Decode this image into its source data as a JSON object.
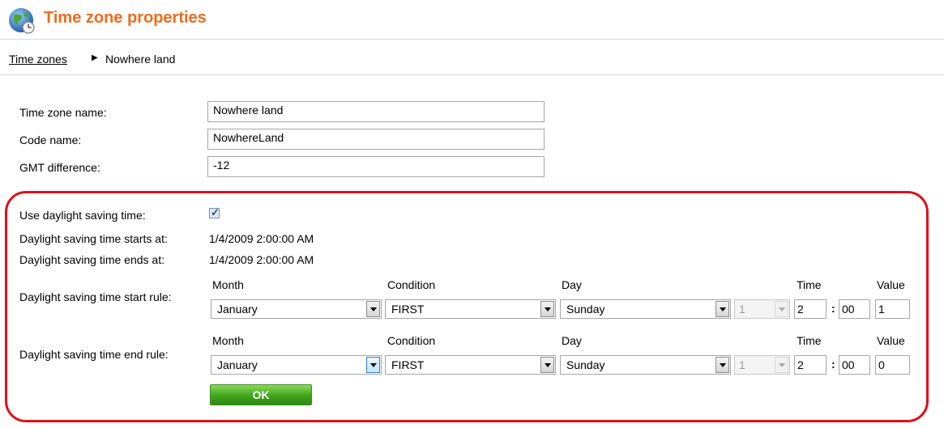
{
  "header": {
    "title": "Time zone properties",
    "icon": "globe-clock-icon"
  },
  "breadcrumb": {
    "parent": "Time zones",
    "current": "Nowhere land"
  },
  "form": {
    "name_label": "Time zone name:",
    "name_value": "Nowhere land",
    "code_label": "Code name:",
    "code_value": "NowhereLand",
    "gmt_label": "GMT difference:",
    "gmt_value": "-12"
  },
  "dst": {
    "use_label": "Use daylight saving time:",
    "use_checked": true,
    "starts_label": "Daylight saving time starts at:",
    "starts_value": "1/4/2009 2:00:00 AM",
    "ends_label": "Daylight saving time ends at:",
    "ends_value": "1/4/2009 2:00:00 AM",
    "columns": {
      "month": "Month",
      "condition": "Condition",
      "day": "Day",
      "time": "Time",
      "value": "Value"
    },
    "start_rule": {
      "label": "Daylight saving time start rule:",
      "month": "January",
      "condition": "FIRST",
      "day": "Sunday",
      "week": "1",
      "hour": "2",
      "minute": "00",
      "value": "1"
    },
    "end_rule": {
      "label": "Daylight saving time end rule:",
      "month": "January",
      "condition": "FIRST",
      "day": "Sunday",
      "week": "1",
      "hour": "2",
      "minute": "00",
      "value": "0"
    },
    "ok_label": "OK"
  },
  "colors": {
    "title": "#f26a1b",
    "highlight_border": "#e0101a",
    "ok_button": "#3fa31b"
  }
}
